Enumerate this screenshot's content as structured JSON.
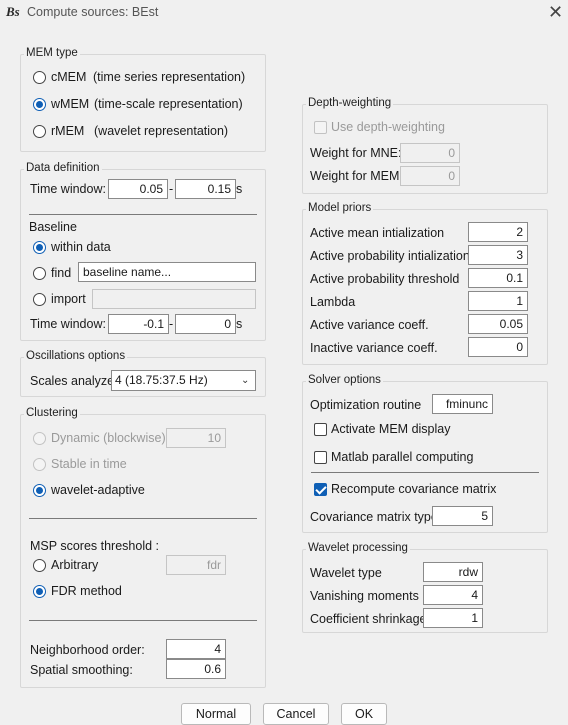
{
  "window": {
    "title": "Compute sources: BEst",
    "app_icon": "Bs"
  },
  "mem_type": {
    "title": "MEM type",
    "options": [
      {
        "name": "cMEM",
        "desc": "(time series representation)"
      },
      {
        "name": "wMEM",
        "desc": "(time-scale representation)"
      },
      {
        "name": "rMEM",
        "desc": "(wavelet representation)"
      }
    ],
    "selected": "wMEM"
  },
  "data_definition": {
    "title": "Data definition",
    "time_window_label": "Time window:",
    "time_start": "0.05",
    "time_end": "0.15",
    "dash": "-",
    "unit": "s",
    "baseline_title": "Baseline",
    "within_data": "within data",
    "find": "find",
    "find_value": "baseline name...",
    "import": "import",
    "import_value": "",
    "baseline_time_label": "Time window:",
    "baseline_start": "-0.1",
    "baseline_end": "0"
  },
  "oscillations": {
    "title": "Oscillations options",
    "scales_label": "Scales analyzed",
    "scales_value": "4 (18.75:37.5 Hz)"
  },
  "clustering": {
    "title": "Clustering",
    "dynamic": "Dynamic (blockwise)",
    "dynamic_value": "10",
    "stable": "Stable in time",
    "wavelet_adaptive": "wavelet-adaptive",
    "msp_title": "MSP scores threshold :",
    "arbitrary": "Arbitrary",
    "arbitrary_value": "fdr",
    "fdr_method": "FDR method",
    "neighborhood_label": "Neighborhood order:",
    "neighborhood_value": "4",
    "spatial_label": "Spatial smoothing:",
    "spatial_value": "0.6"
  },
  "depth_weighting": {
    "title": "Depth-weighting",
    "use_label": "Use depth-weighting",
    "mne_label": "Weight for MNE:",
    "mne_value": "0",
    "mem_label": "Weight for MEM:",
    "mem_value": "0"
  },
  "model_priors": {
    "title": "Model priors",
    "rows": [
      {
        "label": "Active mean intialization",
        "value": "2"
      },
      {
        "label": "Active probability intialization",
        "value": "3"
      },
      {
        "label": "Active probability threshold",
        "value": "0.1"
      },
      {
        "label": "Lambda",
        "value": "1"
      },
      {
        "label": "Active variance coeff.",
        "value": "0.05"
      },
      {
        "label": "Inactive variance coeff.",
        "value": "0"
      }
    ]
  },
  "solver": {
    "title": "Solver options",
    "optimization_label": "Optimization routine",
    "optimization_value": "fminunc",
    "activate_display": "Activate MEM display",
    "parallel": "Matlab parallel computing",
    "recompute_cov": "Recompute covariance matrix",
    "cov_type_label": "Covariance matrix type",
    "cov_type_value": "5"
  },
  "wavelet": {
    "title": "Wavelet processing",
    "type_label": "Wavelet type",
    "type_value": "rdw",
    "vanishing_label": "Vanishing moments",
    "vanishing_value": "4",
    "shrinkage_label": "Coefficient shrinkage",
    "shrinkage_value": "1"
  },
  "buttons": {
    "normal": "Normal",
    "cancel": "Cancel",
    "ok": "OK"
  },
  "colors": {
    "accent": "#0f5fb5",
    "background": "#f0f0f0"
  }
}
